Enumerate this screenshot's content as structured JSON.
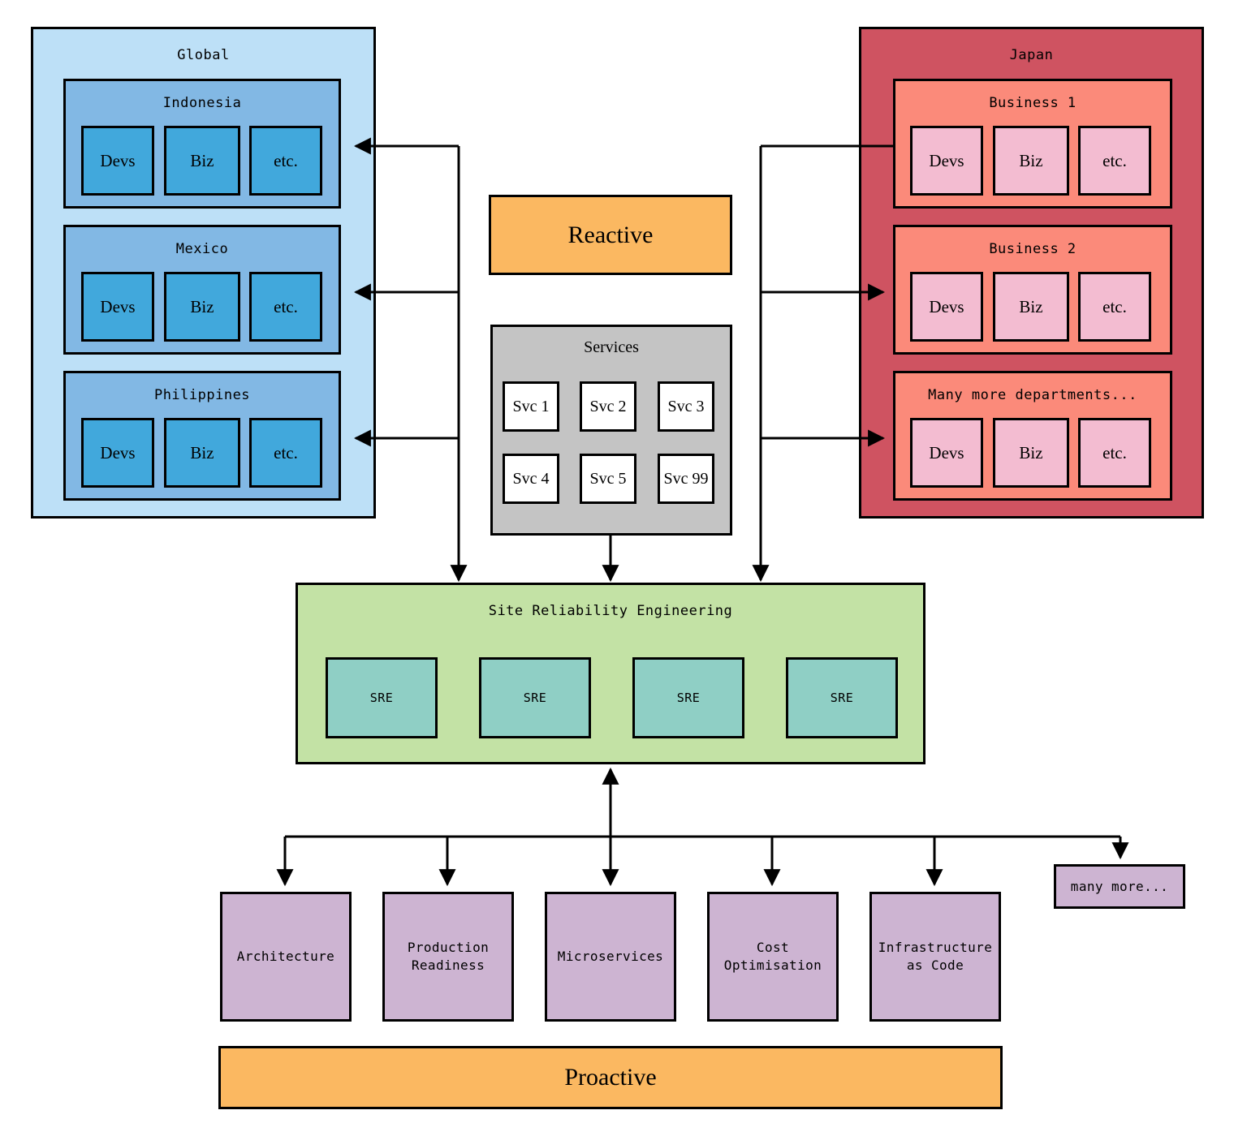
{
  "diagram": {
    "title_reactive": "Reactive",
    "title_proactive": "Proactive"
  },
  "colors": {
    "region_blue_outer": "#bde0f7",
    "region_blue_mid": "#82b8e4",
    "region_blue_inner": "#41a8dc",
    "region_red_outer": "#cf5361",
    "region_red_mid": "#fb8a7a",
    "region_red_inner": "#f3bcd1",
    "services_panel": "#c4c4c4",
    "services_tile": "#ffffff",
    "sre_panel": "#c3e2a5",
    "sre_tile": "#8fcfc5",
    "practice": "#cdb4d2",
    "banner_orange": "#fbb861",
    "stroke": "#000000"
  },
  "regions": [
    {
      "name": "Global",
      "groups": [
        {
          "name": "Indonesia",
          "units": [
            "Devs",
            "Biz",
            "etc."
          ]
        },
        {
          "name": "Mexico",
          "units": [
            "Devs",
            "Biz",
            "etc."
          ]
        },
        {
          "name": "Philippines",
          "units": [
            "Devs",
            "Biz",
            "etc."
          ]
        }
      ]
    },
    {
      "name": "Japan",
      "groups": [
        {
          "name": "Business 1",
          "units": [
            "Devs",
            "Biz",
            "etc."
          ]
        },
        {
          "name": "Business 2",
          "units": [
            "Devs",
            "Biz",
            "etc."
          ]
        },
        {
          "name": "Many more departments...",
          "units": [
            "Devs",
            "Biz",
            "etc."
          ]
        }
      ]
    }
  ],
  "services": {
    "title": "Services",
    "tiles": [
      "Svc  1",
      "Svc 2",
      "Svc 3",
      "Svc 4",
      "Svc 5",
      "Svc 99"
    ]
  },
  "sre": {
    "title": "Site Reliability Engineering",
    "tiles": [
      "SRE",
      "SRE",
      "SRE",
      "SRE"
    ]
  },
  "practices": [
    "Architecture",
    "Production\nReadiness",
    "Microservices",
    "Cost\nOptimisation",
    "Infrastructure\nas Code"
  ],
  "many_more": "many more..."
}
